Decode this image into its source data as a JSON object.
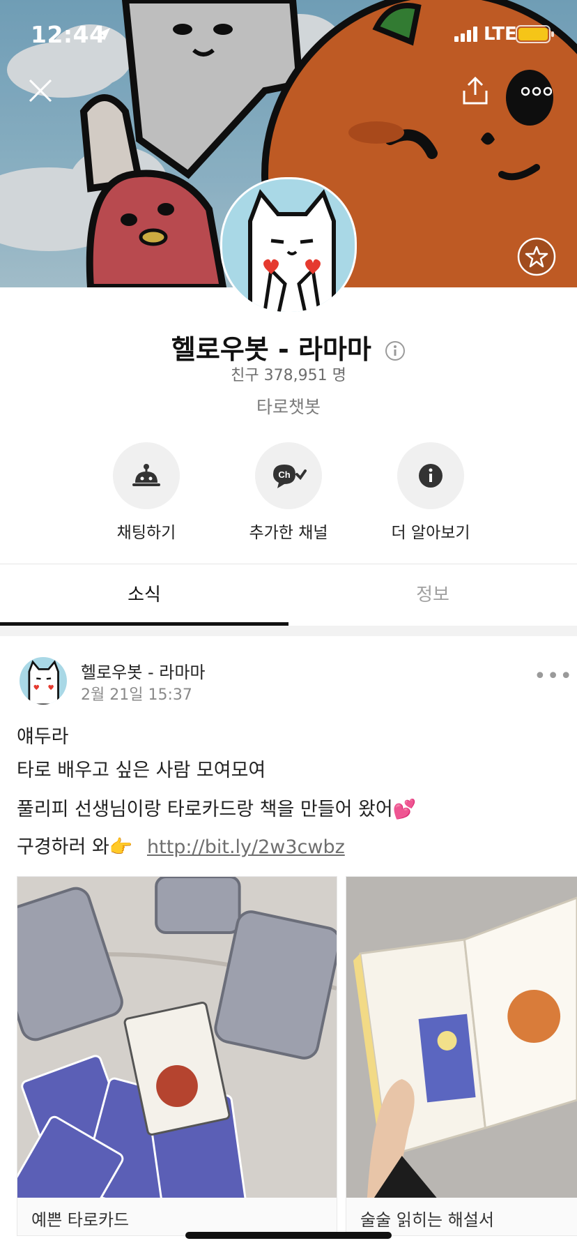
{
  "status_bar": {
    "time": "12:44",
    "network": "LTE"
  },
  "profile": {
    "name": "헬로우봇 - 라마마",
    "friends": "친구 378,951 명",
    "category": "타로챗봇"
  },
  "actions": [
    {
      "label": "채팅하기",
      "icon": "robot-bell-icon"
    },
    {
      "label": "추가한 채널",
      "icon": "channel-added-icon"
    },
    {
      "label": "더 알아보기",
      "icon": "info-icon"
    }
  ],
  "tabs": [
    {
      "label": "소식",
      "active": true
    },
    {
      "label": "정보",
      "active": false
    }
  ],
  "post": {
    "author": "헬로우봇 - 라마마",
    "date": "2월 21일 15:37",
    "lines": [
      "얘두라",
      "타로 배우고 싶은 사람 모여모여",
      "풀리피 선생님이랑 타로카드랑 책을 만들어 왔어💕",
      "구경하러 와👉"
    ],
    "link": "http://bit.ly/2w3cwbz",
    "photos": [
      {
        "caption": "예쁜 타로카드"
      },
      {
        "caption": "술술 읽히는 해설서"
      }
    ]
  },
  "colors": {
    "accent": "#111111",
    "avatar_bg": "#a9d8e6"
  }
}
